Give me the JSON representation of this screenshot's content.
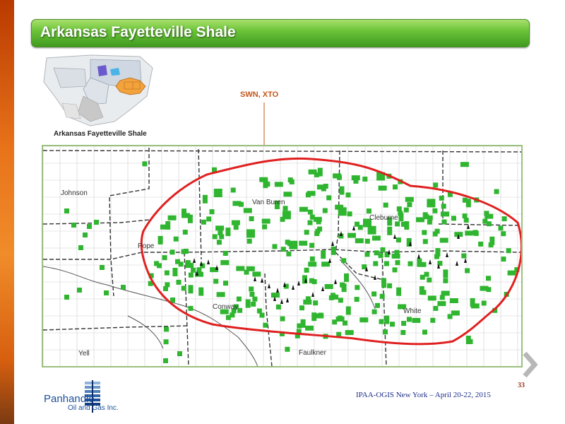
{
  "slide": {
    "title": "Arkansas Fayetteville Shale",
    "inset_caption": "Arkansas Fayetteville Shale",
    "operator_label": "SWN, XTO",
    "page_number": "33",
    "footer": "IPAA-OGIS New York – April 20-22, 2015"
  },
  "map": {
    "counties": [
      "Johnson",
      "Van Buren",
      "Cleburne",
      "Pope",
      "Conway",
      "White",
      "Yell",
      "Faulkner"
    ],
    "colors": {
      "well_square": "#2fb52f",
      "play_outline": "#e02020",
      "grid": "#b8b8b8",
      "county_line": "#333333"
    }
  },
  "logo": {
    "name": "Panhandle",
    "sub": "Oil and Gas Inc."
  },
  "colors": {
    "title_green": "#3f9a1f",
    "accent_orange": "#e8731a",
    "footer_blue": "#1e2f8a"
  },
  "icons": {
    "next": "chevron-right-icon"
  }
}
